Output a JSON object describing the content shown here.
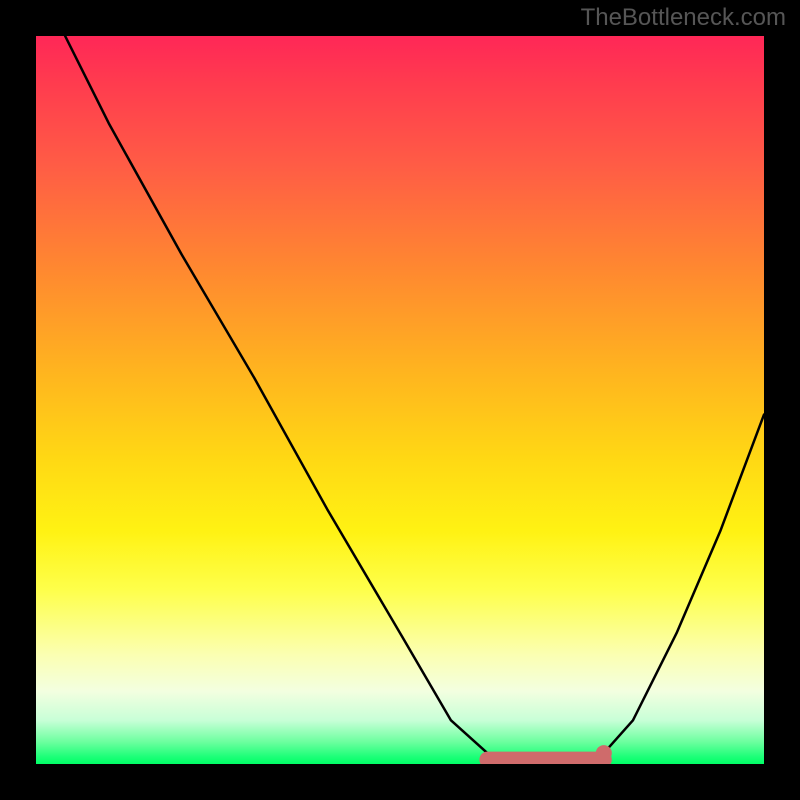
{
  "watermark": "TheBottleneck.com",
  "chart_data": {
    "type": "line",
    "title": "",
    "xlabel": "",
    "ylabel": "",
    "xlim": [
      0,
      100
    ],
    "ylim": [
      0,
      100
    ],
    "series": [
      {
        "name": "bottleneck-curve",
        "x": [
          4,
          10,
          20,
          30,
          40,
          50,
          57,
          62,
          65,
          70,
          75,
          78,
          82,
          88,
          94,
          100
        ],
        "y": [
          100,
          88,
          70,
          53,
          35,
          18,
          6,
          1.5,
          0.5,
          0.5,
          0.5,
          1.5,
          6,
          18,
          32,
          48
        ]
      }
    ],
    "optimal_band": {
      "x_start": 62,
      "x_end": 78,
      "y": 0.6
    },
    "optimal_dot": {
      "x": 78,
      "y": 1.5
    },
    "colors": {
      "curve": "#000000",
      "band": "#cf6b6b",
      "dot": "#cf6b6b",
      "gradient_top": "#ff2757",
      "gradient_bottom": "#00ff66",
      "frame": "#000000"
    }
  }
}
